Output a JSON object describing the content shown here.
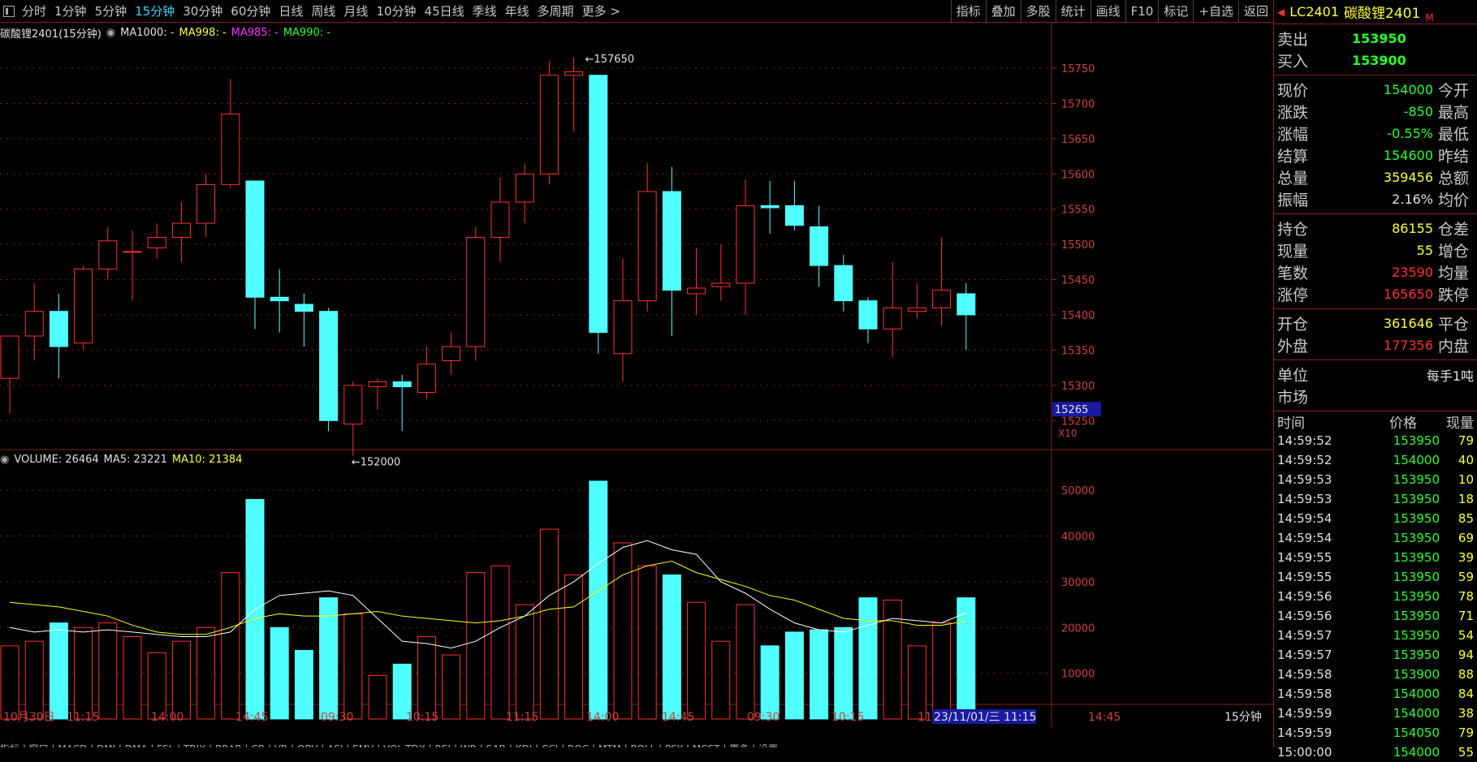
{
  "periods": [
    "分时",
    "1分钟",
    "5分钟",
    "15分钟",
    "30分钟",
    "60分钟",
    "日线",
    "周线",
    "月线",
    "10分钟",
    "45日线",
    "季线",
    "年线",
    "多周期",
    "更多 >"
  ],
  "active_period": "15分钟",
  "toolbar": [
    "指标",
    "叠加",
    "多股",
    "统计",
    "画线",
    "F10",
    "标记",
    "+自选",
    "返回"
  ],
  "info": {
    "name": "碳酸锂2401(15分钟)",
    "ma1000": "MA1000: -",
    "ma998": "MA998: -",
    "ma985": "MA985: -",
    "ma990": "MA990: -"
  },
  "vol_info": {
    "volume": "VOLUME: 26464",
    "ma5": "MA5: 23221",
    "ma10": "MA10: 21384"
  },
  "colors": {
    "up": "#ff3030",
    "down": "#50ffff",
    "ma5": "#ffffff",
    "ma10": "#ffff00",
    "axis": "#8a2020",
    "grid": "#8a2020"
  },
  "annotations": {
    "high": "157650",
    "low": "152000",
    "price_tag": "15265",
    "x10": "X10"
  },
  "period_label": "15分钟",
  "bottom_tabs": "指标 | 窗口 | MACD | DMI | DMA | FSL | TRIX | BRAR | CR | VR | OBV | ASI | EMV | VOL-TDX | RSI | WR | SAR | KDJ | CCI | ROC | MTM | BOLL | PSY | MCST | 更多 | 设置",
  "chart_data": {
    "type": "candlestick",
    "price_axis": {
      "ticks": [
        "15750",
        "15700",
        "15650",
        "15600",
        "15550",
        "15500",
        "15450",
        "15400",
        "15350",
        "15300",
        "15250"
      ],
      "min": 15210,
      "max": 15780
    },
    "volume_axis": {
      "ticks": [
        "50000",
        "40000",
        "30000",
        "20000",
        "10000"
      ],
      "max": 55000
    },
    "x_labels": [
      "10月30日",
      "11:15",
      "14:00",
      "14:45",
      "09:30",
      "10:15",
      "11:15",
      "14:00",
      "14:45",
      "09:30",
      "10:15",
      "11",
      "14:45"
    ],
    "cursor_label": "23/11/01/三 11:15",
    "candles": [
      {
        "o": 15310,
        "h": 15370,
        "l": 15260,
        "c": 15370,
        "v": 16000
      },
      {
        "o": 15370,
        "h": 15445,
        "l": 15335,
        "c": 15405,
        "v": 17000
      },
      {
        "o": 15405,
        "h": 15430,
        "l": 15310,
        "c": 15355,
        "v": 21000
      },
      {
        "o": 15360,
        "h": 15470,
        "l": 15350,
        "c": 15465,
        "v": 20000
      },
      {
        "o": 15465,
        "h": 15525,
        "l": 15450,
        "c": 15505,
        "v": 21000
      },
      {
        "o": 15490,
        "h": 15520,
        "l": 15420,
        "c": 15490,
        "v": 18000
      },
      {
        "o": 15495,
        "h": 15530,
        "l": 15480,
        "c": 15510,
        "v": 14500
      },
      {
        "o": 15510,
        "h": 15560,
        "l": 15475,
        "c": 15530,
        "v": 17000
      },
      {
        "o": 15530,
        "h": 15600,
        "l": 15510,
        "c": 15585,
        "v": 20000
      },
      {
        "o": 15585,
        "h": 15735,
        "l": 15580,
        "c": 15685,
        "v": 32000
      },
      {
        "o": 15590,
        "h": 15590,
        "l": 15380,
        "c": 15425,
        "v": 48000
      },
      {
        "o": 15425,
        "h": 15465,
        "l": 15375,
        "c": 15420,
        "v": 20000
      },
      {
        "o": 15415,
        "h": 15430,
        "l": 15355,
        "c": 15405,
        "v": 15000
      },
      {
        "o": 15405,
        "h": 15410,
        "l": 15235,
        "c": 15250,
        "v": 26500
      },
      {
        "o": 15245,
        "h": 15305,
        "l": 15200,
        "c": 15300,
        "v": 23000
      },
      {
        "o": 15298,
        "h": 15310,
        "l": 15265,
        "c": 15305,
        "v": 9500
      },
      {
        "o": 15305,
        "h": 15315,
        "l": 15235,
        "c": 15298,
        "v": 12000
      },
      {
        "o": 15290,
        "h": 15355,
        "l": 15280,
        "c": 15330,
        "v": 18000
      },
      {
        "o": 15335,
        "h": 15375,
        "l": 15315,
        "c": 15355,
        "v": 14000
      },
      {
        "o": 15355,
        "h": 15525,
        "l": 15335,
        "c": 15510,
        "v": 32000
      },
      {
        "o": 15510,
        "h": 15595,
        "l": 15475,
        "c": 15560,
        "v": 33500
      },
      {
        "o": 15560,
        "h": 15615,
        "l": 15530,
        "c": 15600,
        "v": 25000
      },
      {
        "o": 15600,
        "h": 15760,
        "l": 15585,
        "c": 15740,
        "v": 41500
      },
      {
        "o": 15740,
        "h": 15765,
        "l": 15660,
        "c": 15745,
        "v": 31500
      },
      {
        "o": 15740,
        "h": 15740,
        "l": 15345,
        "c": 15375,
        "v": 52000
      },
      {
        "o": 15345,
        "h": 15480,
        "l": 15305,
        "c": 15420,
        "v": 38500
      },
      {
        "o": 15420,
        "h": 15615,
        "l": 15405,
        "c": 15575,
        "v": 33500
      },
      {
        "o": 15575,
        "h": 15610,
        "l": 15370,
        "c": 15435,
        "v": 31500
      },
      {
        "o": 15430,
        "h": 15495,
        "l": 15400,
        "c": 15438,
        "v": 25500
      },
      {
        "o": 15440,
        "h": 15500,
        "l": 15420,
        "c": 15445,
        "v": 17000
      },
      {
        "o": 15445,
        "h": 15592,
        "l": 15400,
        "c": 15555,
        "v": 25000
      },
      {
        "o": 15555,
        "h": 15590,
        "l": 15515,
        "c": 15552,
        "v": 16000
      },
      {
        "o": 15555,
        "h": 15590,
        "l": 15520,
        "c": 15527,
        "v": 19000
      },
      {
        "o": 15525,
        "h": 15555,
        "l": 15440,
        "c": 15470,
        "v": 19500
      },
      {
        "o": 15470,
        "h": 15485,
        "l": 15405,
        "c": 15420,
        "v": 20000
      },
      {
        "o": 15420,
        "h": 15425,
        "l": 15360,
        "c": 15380,
        "v": 26500
      },
      {
        "o": 15380,
        "h": 15475,
        "l": 15340,
        "c": 15410,
        "v": 26000
      },
      {
        "o": 15405,
        "h": 15445,
        "l": 15395,
        "c": 15410,
        "v": 16000
      },
      {
        "o": 15410,
        "h": 15510,
        "l": 15385,
        "c": 15435,
        "v": 21000
      },
      {
        "o": 15430,
        "h": 15445,
        "l": 15350,
        "c": 15400,
        "v": 26500
      }
    ],
    "ma5": [
      20000,
      19000,
      19500,
      19000,
      19500,
      19000,
      18500,
      18000,
      18000,
      19000,
      24000,
      27000,
      27500,
      28000,
      27000,
      22000,
      17000,
      16500,
      15500,
      17000,
      20000,
      22500,
      27000,
      30000,
      34000,
      37500,
      39000,
      37000,
      36000,
      30000,
      27500,
      24000,
      21000,
      19500,
      19000,
      20500,
      22000,
      21500,
      21000,
      23200
    ],
    "ma10": [
      25500,
      25000,
      24500,
      23500,
      22500,
      20500,
      19000,
      18500,
      18500,
      20000,
      22000,
      23000,
      22500,
      22500,
      23000,
      23500,
      22500,
      22000,
      21500,
      21000,
      21500,
      22500,
      24000,
      24500,
      28000,
      31500,
      33500,
      34500,
      32000,
      30500,
      29000,
      27000,
      26000,
      24000,
      22000,
      21500,
      21500,
      20500,
      20500,
      21400
    ]
  },
  "side": {
    "code": "LC2401",
    "name": "碳酸锂2401",
    "flag": "M",
    "ask_label": "卖出",
    "ask": "153950",
    "bid_label": "买入",
    "bid": "153900",
    "quote1": [
      {
        "l": "现价",
        "v": "154000",
        "c": "g",
        "r": "今开"
      },
      {
        "l": "涨跌",
        "v": "-850",
        "c": "g",
        "r": "最高"
      },
      {
        "l": "涨幅",
        "v": "-0.55%",
        "c": "g",
        "r": "最低"
      },
      {
        "l": "结算",
        "v": "154600",
        "c": "g",
        "r": "昨结"
      },
      {
        "l": "总量",
        "v": "359456",
        "c": "y",
        "r": "总额"
      },
      {
        "l": "振幅",
        "v": "2.16%",
        "c": "w",
        "r": "均价"
      }
    ],
    "quote2": [
      {
        "l": "持仓",
        "v": "86155",
        "c": "y",
        "r": "仓差"
      },
      {
        "l": "现量",
        "v": "55",
        "c": "y",
        "r": "增仓"
      },
      {
        "l": "笔数",
        "v": "23590",
        "c": "r",
        "r": "均量"
      },
      {
        "l": "涨停",
        "v": "165650",
        "c": "r",
        "r": "跌停"
      }
    ],
    "quote3": [
      {
        "l": "开仓",
        "v": "361646",
        "c": "y",
        "r": "平仓"
      },
      {
        "l": "外盘",
        "v": "177356",
        "c": "r",
        "r": "内盘"
      }
    ],
    "unit_label": "单位",
    "unit_value": "每手1吨",
    "market_label": "市场",
    "tick_headers": [
      "时间",
      "价格",
      "现量"
    ],
    "ticks": [
      [
        "14:59:52",
        "153950",
        "79"
      ],
      [
        "14:59:52",
        "154000",
        "40"
      ],
      [
        "14:59:53",
        "153950",
        "10"
      ],
      [
        "14:59:53",
        "153950",
        "18"
      ],
      [
        "14:59:54",
        "153950",
        "85"
      ],
      [
        "14:59:54",
        "153950",
        "69"
      ],
      [
        "14:59:55",
        "153950",
        "39"
      ],
      [
        "14:59:55",
        "153950",
        "59"
      ],
      [
        "14:59:56",
        "153950",
        "78"
      ],
      [
        "14:59:56",
        "153950",
        "71"
      ],
      [
        "14:59:57",
        "153950",
        "54"
      ],
      [
        "14:59:57",
        "153950",
        "94"
      ],
      [
        "14:59:58",
        "153900",
        "88"
      ],
      [
        "14:59:58",
        "154000",
        "84"
      ],
      [
        "14:59:59",
        "154000",
        "38"
      ],
      [
        "14:59:59",
        "154050",
        "79"
      ],
      [
        "15:00:00",
        "154000",
        "55"
      ]
    ]
  }
}
